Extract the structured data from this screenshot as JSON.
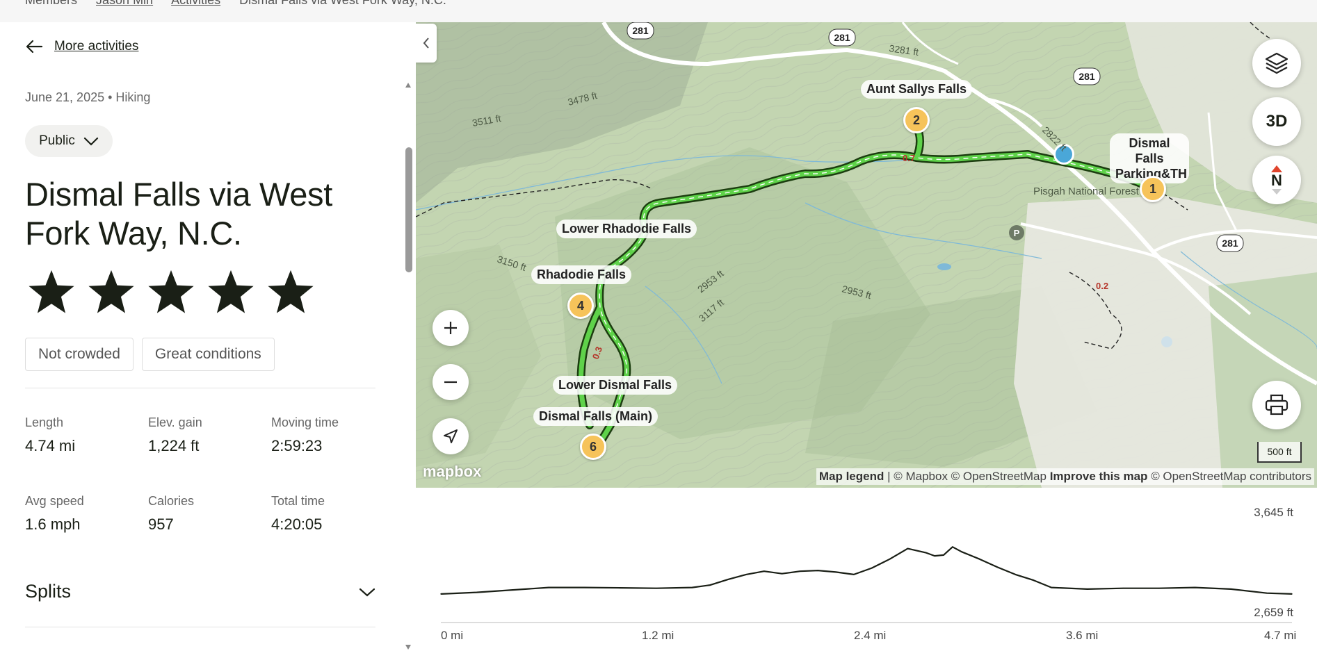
{
  "breadcrumb": {
    "items": [
      "Members",
      "Jason Min",
      "Activities",
      "Dismal Falls via West Fork Way, N.C."
    ]
  },
  "nav": {
    "back_label": "More activities"
  },
  "activity": {
    "date_type": "June 21, 2025 • Hiking",
    "visibility": "Public",
    "title": "Dismal Falls via West Fork Way, N.C.",
    "rating": 5,
    "tags": [
      "Not crowded",
      "Great conditions"
    ]
  },
  "stats": [
    {
      "label": "Length",
      "value": "4.74 mi"
    },
    {
      "label": "Elev. gain",
      "value": "1,224 ft"
    },
    {
      "label": "Moving time",
      "value": "2:59:23"
    },
    {
      "label": "Avg speed",
      "value": "1.6 mph"
    },
    {
      "label": "Calories",
      "value": "957"
    },
    {
      "label": "Total time",
      "value": "4:20:05"
    }
  ],
  "splits": {
    "label": "Splits"
  },
  "map": {
    "waypoints": [
      {
        "num": "1",
        "label": "Dismal Falls Parking&TH"
      },
      {
        "num": "2",
        "label": "Aunt Sallys Falls"
      },
      {
        "num": "4",
        "label": "Rhadodie Falls"
      },
      {
        "num": "6",
        "label": "Dismal Falls (Main)"
      }
    ],
    "extra_labels": [
      "Lower Rhadodie Falls",
      "Lower Dismal Falls"
    ],
    "road_shields": [
      "281",
      "281",
      "281",
      "281"
    ],
    "contours": [
      "3281 ft",
      "3478 ft",
      "3511 ft",
      "2822 ft",
      "3150 ft",
      "2953 ft",
      "2953 ft",
      "3117 ft"
    ],
    "segment_labels": [
      "0.7",
      "0.3",
      "0.2"
    ],
    "place_label": "Pisgah National Forest",
    "parking_symbol": "P",
    "btn_3d": "3D",
    "compass": "N",
    "scale": "500 ft",
    "logo": "mapbox",
    "attribution": {
      "legend": "Map legend",
      "mapbox": "| © Mapbox © OpenStreetMap",
      "improve": "Improve this map",
      "osm": "© OpenStreetMap contributors"
    },
    "colors": {
      "trail": "#5fd24a",
      "trail_edge": "#1c3d10",
      "marker": "#f6c35a",
      "location": "#4aa7d8"
    }
  },
  "chart_data": {
    "type": "line",
    "title": "",
    "xlabel": "",
    "ylabel": "",
    "x_ticks": [
      "0 mi",
      "1.2 mi",
      "2.4 mi",
      "3.6 mi",
      "4.7 mi"
    ],
    "y_labels": [
      "3,645 ft",
      "2,659 ft"
    ],
    "xlim": [
      0,
      4.74
    ],
    "ylim": [
      2659,
      3645
    ],
    "series": [
      {
        "x": [
          0,
          0.2,
          0.4,
          0.6,
          0.8,
          1.0,
          1.2,
          1.4,
          1.5,
          1.6,
          1.7,
          1.8,
          1.9,
          2.0,
          2.1,
          2.2,
          2.3,
          2.4,
          2.5,
          2.6,
          2.7,
          2.75,
          2.8,
          2.85,
          2.9,
          3.0,
          3.1,
          3.2,
          3.3,
          3.4,
          3.6,
          3.8,
          4.0,
          4.2,
          4.4,
          4.6,
          4.74
        ],
        "y": [
          2720,
          2740,
          2770,
          2800,
          2800,
          2795,
          2790,
          2800,
          2830,
          2900,
          2960,
          3000,
          2970,
          3000,
          3010,
          2990,
          2960,
          3040,
          3150,
          3280,
          3230,
          3190,
          3200,
          3300,
          3240,
          3150,
          3050,
          2960,
          2890,
          2800,
          2780,
          2790,
          2790,
          2800,
          2780,
          2730,
          2720
        ]
      }
    ],
    "grid": false
  }
}
